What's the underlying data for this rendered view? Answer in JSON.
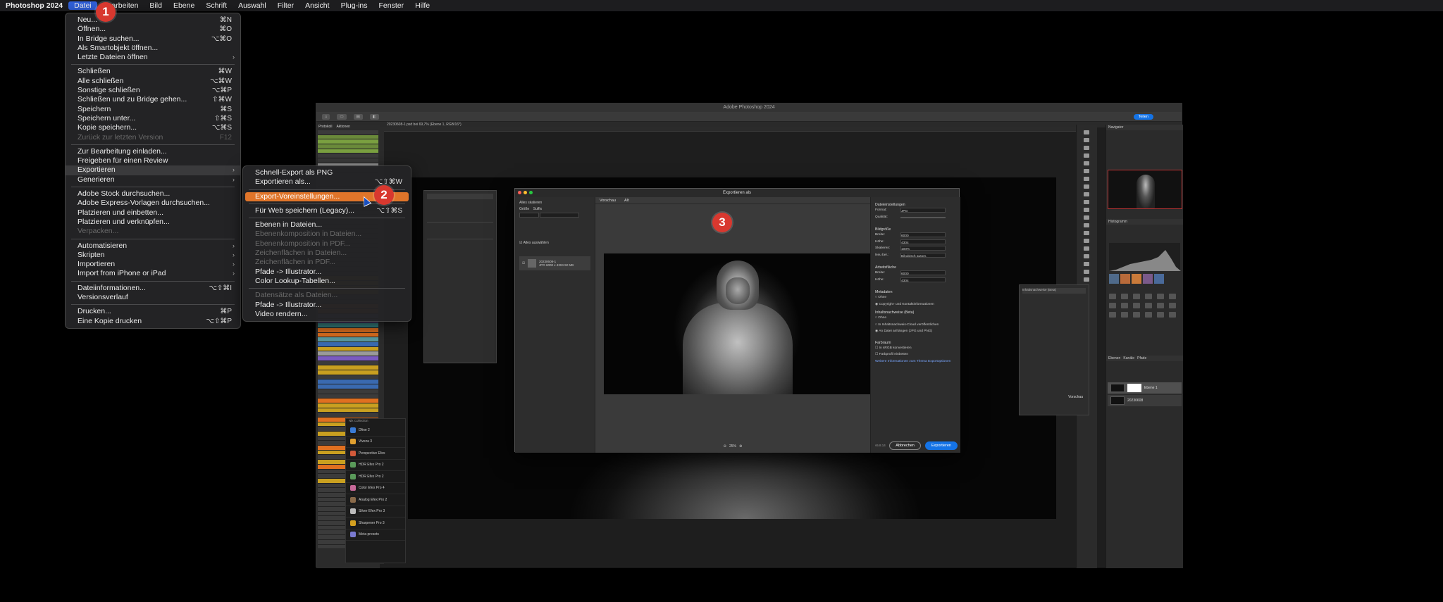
{
  "menubar": {
    "app": "Photoshop 2024",
    "items": [
      "Datei",
      "Bearbeiten",
      "Bild",
      "Ebene",
      "Schrift",
      "Auswahl",
      "Filter",
      "Ansicht",
      "Plug-ins",
      "Fenster",
      "Hilfe"
    ]
  },
  "datei_menu": [
    {
      "label": "Neu...",
      "shortcut": "⌘N"
    },
    {
      "label": "Öffnen...",
      "shortcut": "⌘O"
    },
    {
      "label": "In Bridge suchen...",
      "shortcut": "⌥⌘O"
    },
    {
      "label": "Als Smartobjekt öffnen...",
      "shortcut": ""
    },
    {
      "label": "Letzte Dateien öffnen",
      "shortcut": "",
      "submenu": true
    },
    {
      "sep": true
    },
    {
      "label": "Schließen",
      "shortcut": "⌘W"
    },
    {
      "label": "Alle schließen",
      "shortcut": "⌥⌘W"
    },
    {
      "label": "Sonstige schließen",
      "shortcut": "⌥⌘P"
    },
    {
      "label": "Schließen und zu Bridge gehen...",
      "shortcut": "⇧⌘W"
    },
    {
      "label": "Speichern",
      "shortcut": "⌘S"
    },
    {
      "label": "Speichern unter...",
      "shortcut": "⇧⌘S"
    },
    {
      "label": "Kopie speichern...",
      "shortcut": "⌥⌘S"
    },
    {
      "label": "Zurück zur letzten Version",
      "shortcut": "F12",
      "disabled": true
    },
    {
      "sep": true
    },
    {
      "label": "Zur Bearbeitung einladen...",
      "shortcut": ""
    },
    {
      "label": "Freigeben für einen Review",
      "shortcut": ""
    },
    {
      "label": "Exportieren",
      "shortcut": "",
      "submenu": true,
      "highlighted": true
    },
    {
      "label": "Generieren",
      "shortcut": "",
      "submenu": true
    },
    {
      "sep": true
    },
    {
      "label": "Adobe Stock durchsuchen...",
      "shortcut": ""
    },
    {
      "label": "Adobe Express-Vorlagen durchsuchen...",
      "shortcut": ""
    },
    {
      "label": "Platzieren und einbetten...",
      "shortcut": ""
    },
    {
      "label": "Platzieren und verknüpfen...",
      "shortcut": ""
    },
    {
      "label": "Verpacken...",
      "shortcut": "",
      "disabled": true
    },
    {
      "sep": true
    },
    {
      "label": "Automatisieren",
      "shortcut": "",
      "submenu": true
    },
    {
      "label": "Skripten",
      "shortcut": "",
      "submenu": true
    },
    {
      "label": "Importieren",
      "shortcut": "",
      "submenu": true
    },
    {
      "label": "Import from iPhone or iPad",
      "shortcut": "",
      "submenu": true
    },
    {
      "sep": true
    },
    {
      "label": "Dateiinformationen...",
      "shortcut": "⌥⇧⌘I"
    },
    {
      "label": "Versionsverlauf",
      "shortcut": ""
    },
    {
      "sep": true
    },
    {
      "label": "Drucken...",
      "shortcut": "⌘P"
    },
    {
      "label": "Eine Kopie drucken",
      "shortcut": "⌥⇧⌘P"
    }
  ],
  "export_menu": [
    {
      "label": "Schnell-Export als PNG",
      "shortcut": ""
    },
    {
      "label": "Exportieren als...",
      "shortcut": "⌥⇧⌘W"
    },
    {
      "sep": true
    },
    {
      "label": "Export-Voreinstellungen...",
      "shortcut": "",
      "selected": true
    },
    {
      "sep": true
    },
    {
      "label": "Für Web speichern (Legacy)...",
      "shortcut": "⌥⇧⌘S"
    },
    {
      "sep": true
    },
    {
      "label": "Ebenen in Dateien...",
      "shortcut": ""
    },
    {
      "label": "Ebenenkomposition in Dateien...",
      "shortcut": "",
      "disabled": true
    },
    {
      "label": "Ebenenkomposition in PDF...",
      "shortcut": "",
      "disabled": true
    },
    {
      "label": "Zeichenflächen in Dateien...",
      "shortcut": "",
      "disabled": true
    },
    {
      "label": "Zeichenflächen in PDF...",
      "shortcut": "",
      "disabled": true
    },
    {
      "label": "Pfade -> Illustrator...",
      "shortcut": ""
    },
    {
      "label": "Color Lookup-Tabellen...",
      "shortcut": ""
    },
    {
      "sep": true
    },
    {
      "label": "Datensätze als Dateien...",
      "shortcut": "",
      "disabled": true
    },
    {
      "label": "Pfade -> Illustrator...",
      "shortcut": ""
    },
    {
      "label": "Video rendern...",
      "shortcut": ""
    }
  ],
  "badges": [
    "1",
    "2",
    "3"
  ],
  "ps": {
    "title": "Adobe Photoshop 2024",
    "doc_tab": "20230608-1.psd bei 69,7% (Ebene 1, RGB/16*)",
    "share_label": "Teilen",
    "left_tabs": [
      "Protokoll",
      "Aktionen"
    ],
    "layers_tabs": [
      "Ebenen",
      "Kanäle",
      "Pfade"
    ],
    "layer_names": [
      "Ebene 1",
      "20230608"
    ],
    "nav_label": "Navigator",
    "histo_label": "Histogramm"
  },
  "filters": {
    "header": "Nik Collection",
    "items": [
      "Dfine 2",
      "Viveza 3",
      "Perspective Efex",
      "HDR Efex Pro 2",
      "HDR Efex Pro 2",
      "Color Efex Pro 4",
      "Analog Efex Pro 2",
      "Silver Efex Pro 3",
      "Sharpener Pro 3",
      "Meta presets"
    ]
  },
  "export_dialog": {
    "title": "Exportieren als",
    "left_header": "Alles skalieren",
    "left_labels": [
      "Größe",
      "Suffix"
    ],
    "left_select_all": "Alles auswählen",
    "file_name": "20230608-1",
    "file_meta": "JPG  6000 x 4304  92 MB",
    "tabs": [
      "Vorschau",
      "Alt"
    ],
    "zoom": "25%",
    "right_sections": {
      "file_settings": "Dateieinstellungen",
      "format_label": "Format:",
      "format_value": "JPG",
      "quality_label": "Qualität:",
      "image_size": "Bildgröße",
      "width_label": "Breite:",
      "width_value": "6000",
      "height_label": "Höhe:",
      "height_value": "4304",
      "scale_label": "Skalieren:",
      "scale_value": "100%",
      "resample_label": "Neu ber.:",
      "resample_value": "Bikubisch autom.",
      "canvas_size": "Arbeitsfläche",
      "c_width_value": "6000",
      "c_height_value": "4304",
      "metadata": "Metadaten",
      "meta_opt1": "Ohne",
      "meta_opt2": "Copyright- und Kontaktinformationen",
      "content_credentials": "Inhaltsnachweise (Beta)",
      "cc_opt1": "Ohne",
      "cc_opt2": "In Inhaltsnachweis-Cloud veröffentlichen",
      "cc_opt3": "An Datei anhängen (JPG und PNG)",
      "color_space": "Farbraum",
      "cs_opt1": "In sRGB konvertieren",
      "cs_opt2": "Farbprofil einbetten",
      "learn_more": "Weitere Informationen zum Thema Exportoptionen",
      "version": "v5.8.14",
      "cancel": "Abbrechen",
      "export": "Exportieren"
    }
  },
  "info_panel": {
    "title": "Inhaltsnachweise (Beta)",
    "preview_label": "Vorschau"
  },
  "colors": {
    "menu_selected": "#e0752a",
    "badge": "#d8382f",
    "primary_button": "#1473e6",
    "menubar": "#1d1d1f"
  }
}
